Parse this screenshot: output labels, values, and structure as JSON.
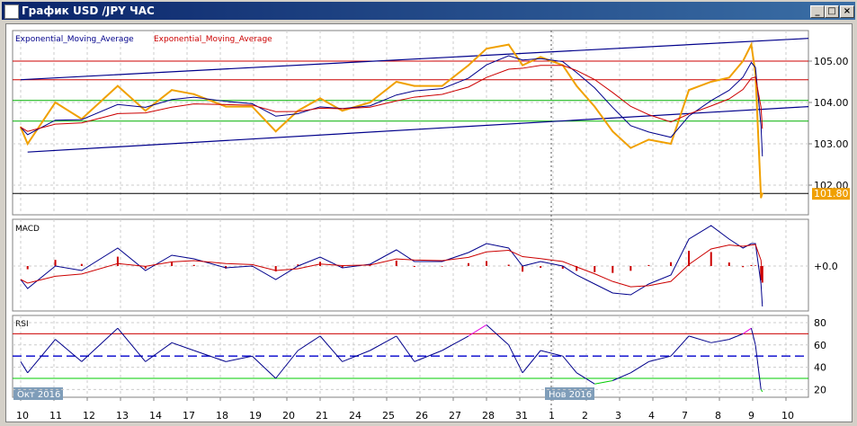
{
  "window": {
    "title": "График USD /JPY  ЧАС",
    "minimize": "_",
    "maximize": "□",
    "close": "×"
  },
  "legend": {
    "ema1": "Exponential_Moving_Average",
    "ema2": "Exponential_Moving_Average",
    "ema1_color": "#00008b",
    "ema2_color": "#cc0000"
  },
  "colors": {
    "price": "#f0a000",
    "macd": "#00008b",
    "signal": "#cc0000",
    "hist": "#cc0000",
    "rsi": "#00008b",
    "rsi_over": "#e000e0",
    "rsi_under": "#00cc00",
    "trend": "#00008b"
  },
  "chart_data": [
    {
      "type": "line",
      "title": "",
      "ylim": [
        101.5,
        105.8
      ],
      "y_ticks": [
        "105.00",
        "104.00",
        "103.00",
        "102.00"
      ],
      "current_price": "101.80",
      "x_ticks": [
        "10",
        "11",
        "12",
        "13",
        "14",
        "17",
        "18",
        "19",
        "20",
        "21",
        "24",
        "25",
        "26",
        "27",
        "28",
        "31",
        "1",
        "2",
        "3",
        "4",
        "7",
        "8",
        "9",
        "10"
      ],
      "month_labels": [
        "Окт 2016",
        "Нов 2016"
      ],
      "series": [
        {
          "values": [
            [
              "2016-10-10 00",
              103.4
            ],
            [
              "2016-10-10 05",
              103.0
            ],
            [
              "2016-10-11 01",
              104.0
            ],
            [
              "2016-10-11 20",
              103.6
            ],
            [
              "2016-10-12 22",
              104.4
            ],
            [
              "2016-10-13 18",
              103.8
            ],
            [
              "2016-10-14 13",
              104.3
            ],
            [
              "2016-10-17 05",
              104.2
            ],
            [
              "2016-10-18 04",
              103.9
            ],
            [
              "2016-10-18 23",
              103.9
            ],
            [
              "2016-10-19 16",
              103.3
            ],
            [
              "2016-10-20 08",
              103.8
            ],
            [
              "2016-10-21 00",
              104.1
            ],
            [
              "2016-10-21 16",
              103.8
            ],
            [
              "2016-10-24 12",
              104.0
            ],
            [
              "2016-10-25 07",
              104.5
            ],
            [
              "2016-10-25 20",
              104.4
            ],
            [
              "2016-10-26 16",
              104.4
            ],
            [
              "2016-10-27 11",
              104.9
            ],
            [
              "2016-10-28 00",
              105.3
            ],
            [
              "2016-10-28 16",
              105.4
            ],
            [
              "2016-10-31 02",
              104.9
            ],
            [
              "2016-10-31 15",
              105.1
            ],
            [
              "2016-11-01 07",
              104.9
            ],
            [
              "2016-11-01 17",
              104.4
            ],
            [
              "2016-11-02 06",
              103.9
            ],
            [
              "2016-11-02 19",
              103.3
            ],
            [
              "2016-11-03 08",
              102.9
            ],
            [
              "2016-11-03 21",
              103.1
            ],
            [
              "2016-11-04 13",
              103.0
            ],
            [
              "2016-11-07 02",
              104.3
            ],
            [
              "2016-11-07 18",
              104.5
            ],
            [
              "2016-11-08 07",
              104.6
            ],
            [
              "2016-11-08 17",
              105.0
            ],
            [
              "2016-11-08 23",
              105.4
            ],
            [
              "2016-11-09 02",
              104.7
            ],
            [
              "2016-11-09 06",
              101.7
            ],
            [
              "2016-11-09 07",
              101.8
            ]
          ]
        }
      ],
      "levels": {
        "red": [
          105.0,
          104.55
        ],
        "green": [
          104.05,
          103.55
        ],
        "black": [
          101.8
        ]
      },
      "trendlines": [
        {
          "from": [
            "2016-10-10 00",
            104.55
          ],
          "to": [
            "2016-11-10 12",
            105.55
          ]
        },
        {
          "from": [
            "2016-10-10 05",
            102.8
          ],
          "to": [
            "2016-11-10 12",
            103.9
          ]
        }
      ]
    },
    {
      "type": "line",
      "title": "MACD",
      "zero_label": "+0.0",
      "values": [
        -0.15,
        -0.25,
        0.0,
        -0.05,
        0.2,
        -0.05,
        0.12,
        0.08,
        -0.02,
        0.0,
        -0.15,
        0.0,
        0.1,
        -0.02,
        0.02,
        0.18,
        0.05,
        0.05,
        0.15,
        0.25,
        0.2,
        0.0,
        0.05,
        0.0,
        -0.1,
        -0.2,
        -0.3,
        -0.32,
        -0.2,
        -0.1,
        0.3,
        0.45,
        0.3,
        0.2,
        0.25,
        0.25,
        -0.2,
        -0.45
      ]
    },
    {
      "type": "line",
      "title": "RSI",
      "ylim": [
        15,
        85
      ],
      "y_ticks": [
        "80",
        "60",
        "40",
        "20"
      ],
      "levels": [
        70,
        50,
        30
      ],
      "values": [
        45,
        35,
        65,
        45,
        75,
        45,
        62,
        55,
        45,
        50,
        30,
        55,
        68,
        45,
        55,
        68,
        45,
        55,
        68,
        78,
        60,
        35,
        55,
        50,
        35,
        25,
        28,
        35,
        45,
        50,
        68,
        62,
        65,
        70,
        75,
        60,
        20,
        18
      ]
    }
  ]
}
